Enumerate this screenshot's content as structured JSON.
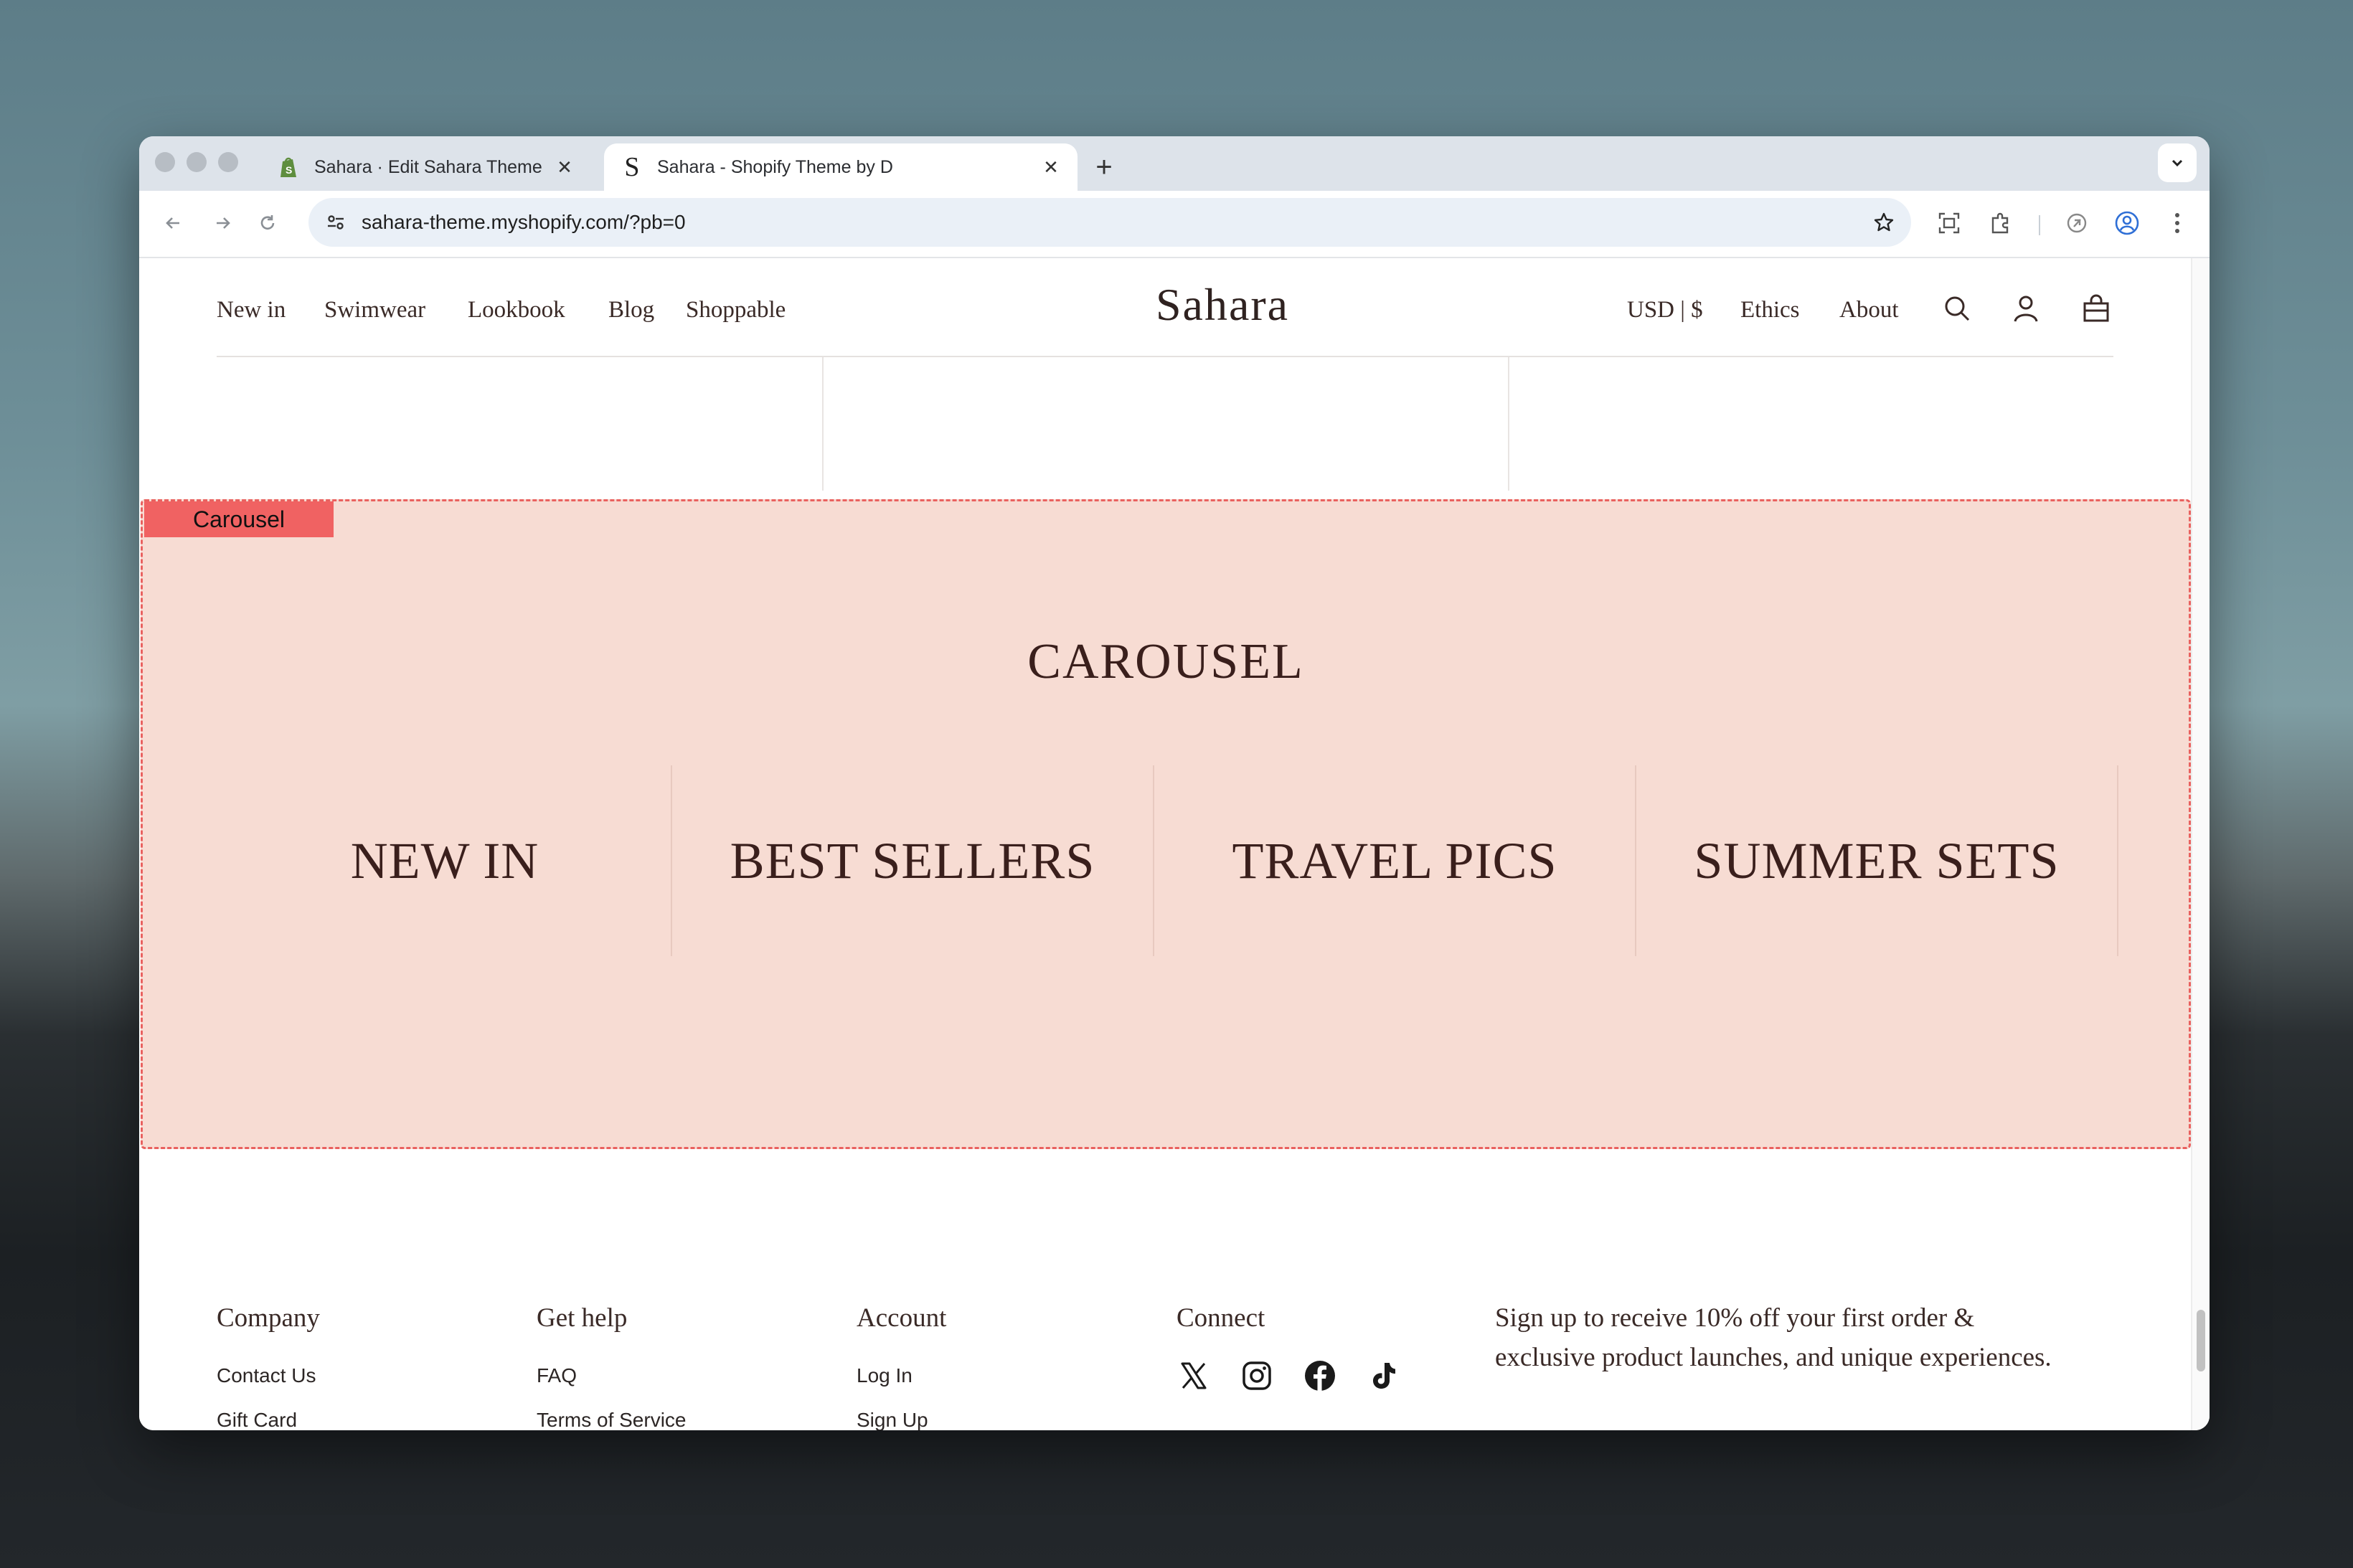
{
  "browser": {
    "tabs": [
      {
        "title": "Sahara · Edit Sahara Theme v",
        "active": false
      },
      {
        "title": "Sahara - Shopify Theme by D",
        "active": true
      }
    ],
    "new_tab": "+",
    "url": "sahara-theme.myshopify.com/?pb=0"
  },
  "site": {
    "nav_left": [
      "New in",
      "Swimwear",
      "Lookbook",
      "Blog",
      "Shoppable"
    ],
    "logo": "Sahara",
    "nav_right": [
      "USD | $",
      "Ethics",
      "About"
    ],
    "icons": [
      "search-icon",
      "account-icon",
      "cart-bag-icon"
    ]
  },
  "carousel": {
    "section_tag": "Carousel",
    "title": "CAROUSEL",
    "categories": [
      "NEW IN",
      "BEST SELLERS",
      "TRAVEL PICS",
      "SUMMER SETS"
    ],
    "background": "#f7dcd3",
    "outline_color": "#e9615f"
  },
  "footer": {
    "columns": [
      {
        "heading": "Company",
        "links": [
          "Contact Us",
          "Gift Card"
        ]
      },
      {
        "heading": "Get help",
        "links": [
          "FAQ",
          "Terms of Service"
        ]
      },
      {
        "heading": "Account",
        "links": [
          "Log In",
          "Sign Up"
        ]
      },
      {
        "heading": "Connect",
        "links": []
      }
    ],
    "social_icons": [
      "x-icon",
      "instagram-icon",
      "facebook-icon",
      "tiktok-icon"
    ],
    "signup_text": "Sign up to receive 10% off your first order & exclusive product launches, and unique experiences."
  }
}
